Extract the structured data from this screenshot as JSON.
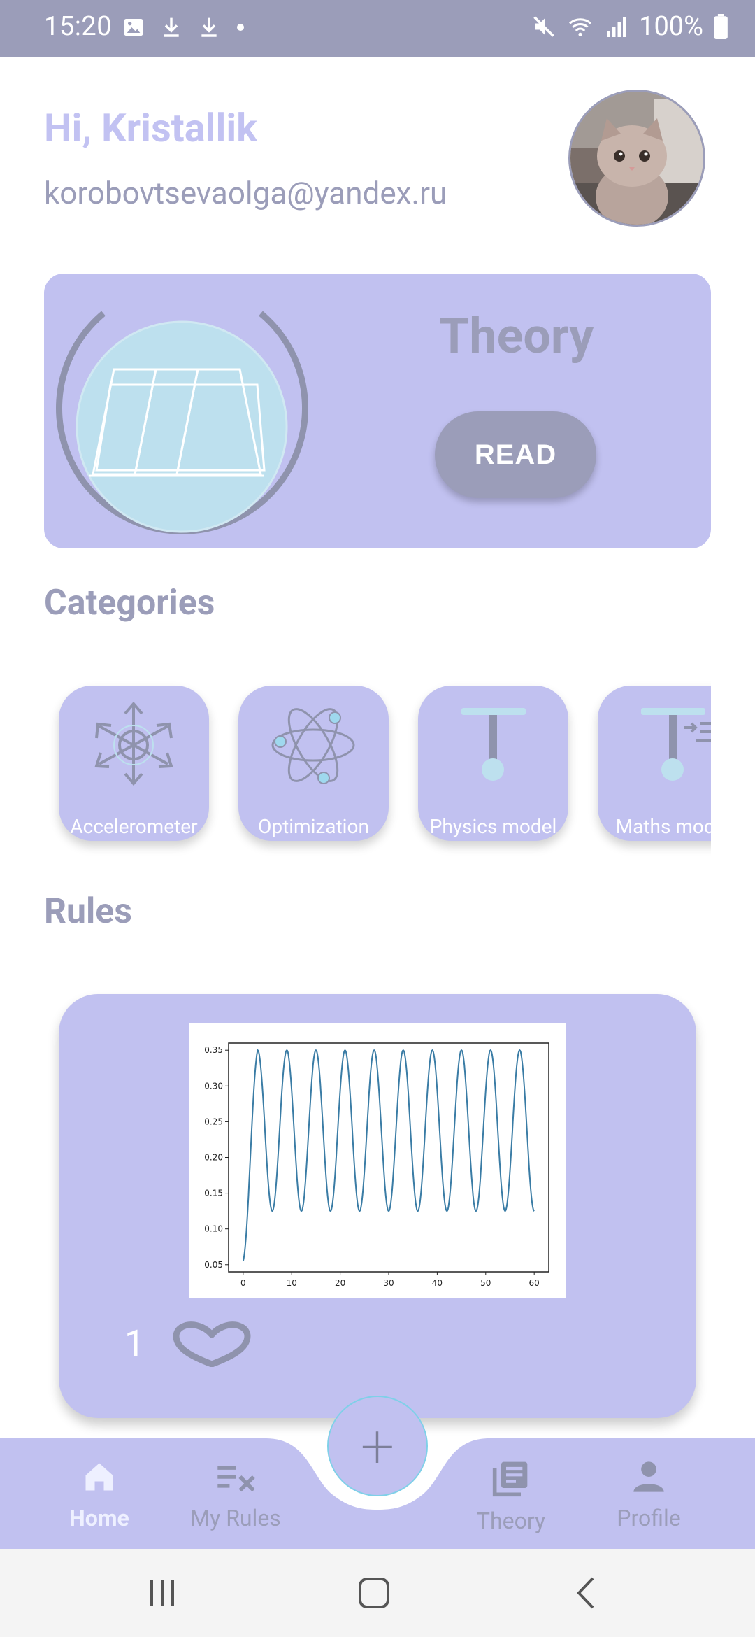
{
  "status_bar": {
    "time": "15:20",
    "battery": "100%",
    "icons": [
      "image-icon",
      "download-icon",
      "download-icon",
      "dot-icon",
      "mute-icon",
      "wifi-icon",
      "signal-icon",
      "battery-icon"
    ]
  },
  "header": {
    "greeting": "Hi, Kristallik",
    "email": "korobovtsevaolga@yandex.ru"
  },
  "theory_card": {
    "title": "Theory",
    "button_label": "READ"
  },
  "sections": {
    "categories_title": "Categories",
    "rules_title": "Rules"
  },
  "categories": [
    {
      "label": "Accelerometer",
      "icon": "accelerometer-icon"
    },
    {
      "label": "Optimization",
      "icon": "atom-icon"
    },
    {
      "label": "Physics model",
      "icon": "pendulum-icon"
    },
    {
      "label": "Maths model",
      "icon": "pendulum-list-icon"
    }
  ],
  "rule": {
    "likes": "1",
    "chart_data": {
      "type": "line",
      "title": "",
      "xlabel": "",
      "ylabel": "",
      "xlim": [
        0,
        60
      ],
      "ylim": [
        0.04,
        0.36
      ],
      "xticks": [
        "0",
        "10",
        "20",
        "30",
        "40",
        "50",
        "60"
      ],
      "yticks": [
        "0.05",
        "0.10",
        "0.15",
        "0.20",
        "0.25",
        "0.30",
        "0.35"
      ],
      "series": [
        {
          "color": "#3a7ca5",
          "formula": "oscillation between 0.125 and 0.35, starting at 0.05, period 6"
        }
      ]
    }
  },
  "bottom_nav": {
    "items": [
      {
        "label": "Home",
        "active": true
      },
      {
        "label": "My Rules",
        "active": false
      },
      {
        "label": "Theory",
        "active": false
      },
      {
        "label": "Profile",
        "active": false
      }
    ],
    "fab_label": "+"
  },
  "colors": {
    "accent": "#c1c1f0",
    "muted": "#9b9db9",
    "light_blue": "#bde0ee"
  }
}
